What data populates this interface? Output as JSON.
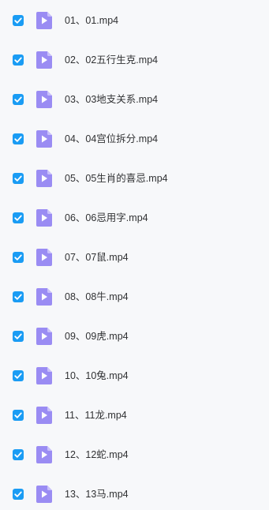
{
  "accent_color": "#1a9cf4",
  "icon_color": "#9a8cf3",
  "files": [
    {
      "name": "01、01.mp4",
      "selected": true,
      "icon": "video-file-icon"
    },
    {
      "name": "02、02五行生克.mp4",
      "selected": true,
      "icon": "video-file-icon"
    },
    {
      "name": "03、03地支关系.mp4",
      "selected": true,
      "icon": "video-file-icon"
    },
    {
      "name": "04、04宫位拆分.mp4",
      "selected": true,
      "icon": "video-file-icon"
    },
    {
      "name": "05、05生肖的喜忌.mp4",
      "selected": true,
      "icon": "video-file-icon"
    },
    {
      "name": "06、06忌用字.mp4",
      "selected": true,
      "icon": "video-file-icon"
    },
    {
      "name": "07、07鼠.mp4",
      "selected": true,
      "icon": "video-file-icon"
    },
    {
      "name": "08、08牛.mp4",
      "selected": true,
      "icon": "video-file-icon"
    },
    {
      "name": "09、09虎.mp4",
      "selected": true,
      "icon": "video-file-icon"
    },
    {
      "name": "10、10兔.mp4",
      "selected": true,
      "icon": "video-file-icon"
    },
    {
      "name": "11、11龙.mp4",
      "selected": true,
      "icon": "video-file-icon"
    },
    {
      "name": "12、12蛇.mp4",
      "selected": true,
      "icon": "video-file-icon"
    },
    {
      "name": "13、13马.mp4",
      "selected": true,
      "icon": "video-file-icon"
    }
  ]
}
